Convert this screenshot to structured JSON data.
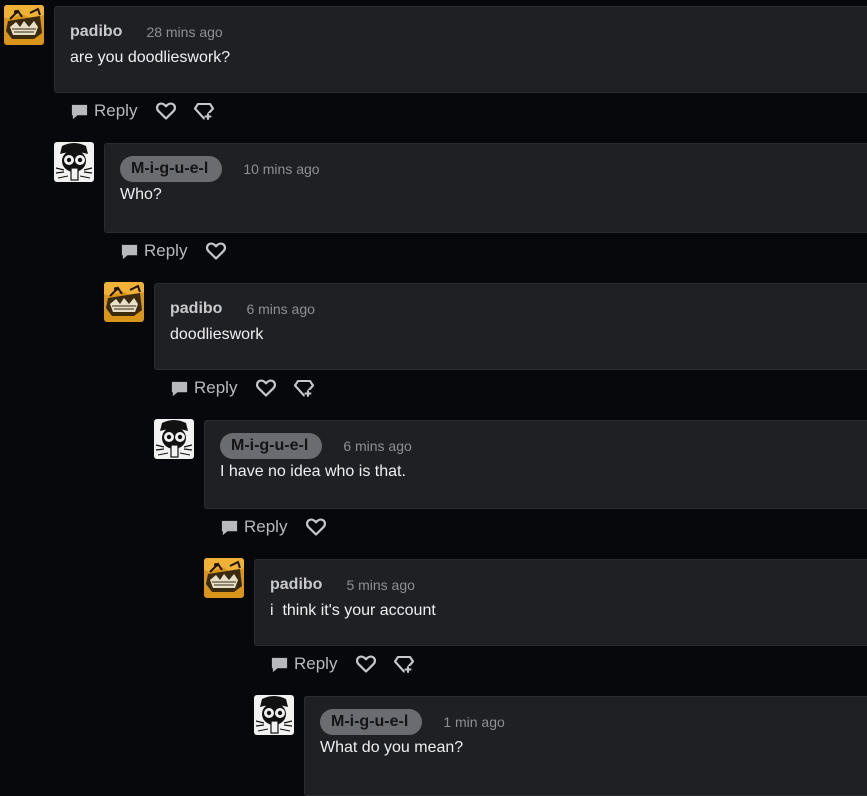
{
  "comments": [
    {
      "username": "padibo",
      "time": "28 mins ago",
      "text": "are you doodlieswork?",
      "reply_label": "Reply",
      "avatar": "padibo-avatar-icon",
      "username_style": "plain",
      "actions": [
        "reply-icon",
        "heart-icon",
        "award-icon"
      ]
    },
    {
      "username": "M-i-g-u-e-l",
      "time": "10 mins ago",
      "text": "Who?",
      "reply_label": "Reply",
      "avatar": "miguel-avatar-icon",
      "username_style": "pill",
      "actions": [
        "reply-icon",
        "heart-icon"
      ]
    },
    {
      "username": "padibo",
      "time": "6 mins ago",
      "text": "doodlieswork",
      "reply_label": "Reply",
      "avatar": "padibo-avatar-icon",
      "username_style": "plain",
      "actions": [
        "reply-icon",
        "heart-icon",
        "award-icon"
      ]
    },
    {
      "username": "M-i-g-u-e-l",
      "time": "6 mins ago",
      "text": "I have no idea who is that.",
      "reply_label": "Reply",
      "avatar": "miguel-avatar-icon",
      "username_style": "pill",
      "actions": [
        "reply-icon",
        "heart-icon"
      ]
    },
    {
      "username": "padibo",
      "time": "5 mins ago",
      "text": "i  think it's your account",
      "reply_label": "Reply",
      "avatar": "padibo-avatar-icon",
      "username_style": "plain",
      "actions": [
        "reply-icon",
        "heart-icon",
        "award-icon"
      ]
    },
    {
      "username": "M-i-g-u-e-l",
      "time": "1 min ago",
      "text": "What do you mean?",
      "avatar": "miguel-avatar-icon",
      "username_style": "pill",
      "actions": []
    }
  ],
  "colors": {
    "page_background": "#07080c",
    "comment_background": "#1f2024",
    "pill_background": "#6b6c72",
    "muted_text": "#8e8f94"
  }
}
